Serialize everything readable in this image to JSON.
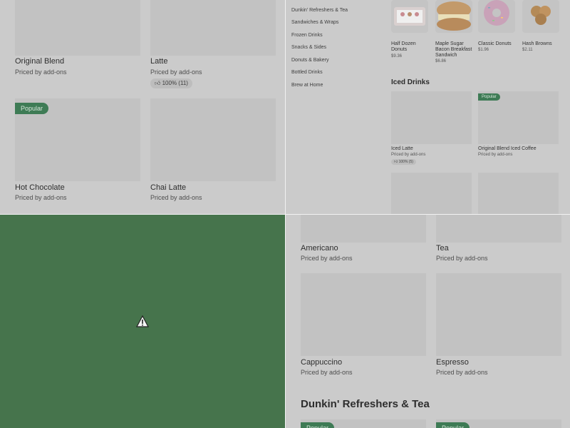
{
  "q1": {
    "items": [
      {
        "name": "Original Blend",
        "price": "Priced by add-ons",
        "badge": "",
        "rating": ""
      },
      {
        "name": "Latte",
        "price": "Priced by add-ons",
        "badge": "",
        "rating": "100% (11)"
      },
      {
        "name": "Hot Chocolate",
        "price": "Priced by add-ons",
        "badge": "Popular",
        "rating": ""
      },
      {
        "name": "Chai Latte",
        "price": "Priced by add-ons",
        "badge": "",
        "rating": ""
      }
    ]
  },
  "q2": {
    "nav": [
      "Dunkin' Refreshers & Tea",
      "Sandwiches & Wraps",
      "Frozen Drinks",
      "Snacks & Sides",
      "Donuts & Bakery",
      "Bottled Drinks",
      "Brew at Home"
    ],
    "featured": [
      {
        "name": "Half Dozen Donuts",
        "price": "$9.36"
      },
      {
        "name": "Maple Sugar Bacon Breakfast Sandwich",
        "price": "$6.86"
      },
      {
        "name": "Classic Donuts",
        "price": "$1.96"
      },
      {
        "name": "Hash Browns",
        "price": "$2.11"
      }
    ],
    "section_title": "Iced Drinks",
    "iced": [
      {
        "name": "Iced Latte",
        "price": "Priced by add-ons",
        "badge": "",
        "rating": "100% (5)"
      },
      {
        "name": "Original Blend Iced Coffee",
        "price": "Priced by add-ons",
        "badge": "Popular",
        "rating": ""
      }
    ]
  },
  "q4": {
    "items": [
      {
        "name": "Americano",
        "price": "Priced by add-ons"
      },
      {
        "name": "Tea",
        "price": "Priced by add-ons"
      },
      {
        "name": "Cappuccino",
        "price": "Priced by add-ons"
      },
      {
        "name": "Espresso",
        "price": "Priced by add-ons"
      }
    ],
    "section_title": "Dunkin' Refreshers & Tea",
    "next_badges": [
      "Popular",
      "Popular"
    ]
  },
  "colors": {
    "accent": "#3e7b55",
    "placeholder": "#c2c2c2",
    "loading_panel": "#46744c"
  },
  "icons": {
    "rating": "thumbs-up-icon",
    "broken_image": "warning-triangle-icon"
  }
}
